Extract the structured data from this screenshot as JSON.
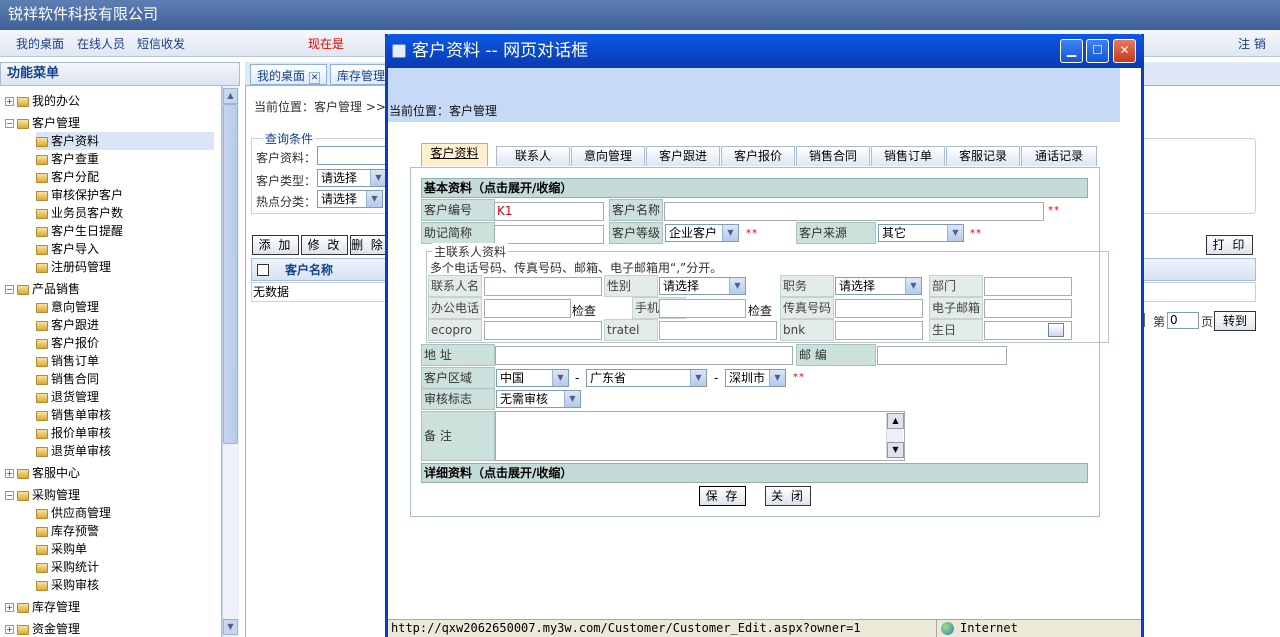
{
  "app": {
    "company": "锐祥软件科技有限公司",
    "nav": [
      "我的桌面",
      "在线人员",
      "短信收发"
    ],
    "now_label": "现在是",
    "logout": "注 销"
  },
  "sidebar": {
    "header": "功能菜单",
    "items": [
      {
        "label": "我的办公"
      },
      {
        "label": "客户管理"
      },
      {
        "label": "客户资料"
      },
      {
        "label": "客户查重"
      },
      {
        "label": "客户分配"
      },
      {
        "label": "审核保护客户"
      },
      {
        "label": "业务员客户数"
      },
      {
        "label": "客户生日提醒"
      },
      {
        "label": "客户导入"
      },
      {
        "label": "注册码管理"
      },
      {
        "label": "产品销售"
      },
      {
        "label": "意向管理"
      },
      {
        "label": "客户跟进"
      },
      {
        "label": "客户报价"
      },
      {
        "label": "销售订单"
      },
      {
        "label": "销售合同"
      },
      {
        "label": "退货管理"
      },
      {
        "label": "销售单审核"
      },
      {
        "label": "报价单审核"
      },
      {
        "label": "退货单审核"
      },
      {
        "label": "客服中心"
      },
      {
        "label": "采购管理"
      },
      {
        "label": "供应商管理"
      },
      {
        "label": "库存预警"
      },
      {
        "label": "采购单"
      },
      {
        "label": "采购统计"
      },
      {
        "label": "采购审核"
      },
      {
        "label": "库存管理"
      },
      {
        "label": "资金管理"
      }
    ]
  },
  "main": {
    "tabs": [
      "我的桌面",
      "库存管理"
    ],
    "breadcrumb": "当前位置：客户管理 >>",
    "query_legend": "查询条件",
    "query_labels": [
      "客户资料：",
      "客户类型：",
      "热点分类："
    ],
    "query_selects": [
      "请选择",
      "请选择"
    ],
    "buttons": [
      "添 加",
      "修 改",
      "删 除"
    ],
    "print_btn": "打 印",
    "grid_header": "客户名称",
    "no_data": "无数据",
    "pager": {
      "page_label": "第",
      "page_value": "0",
      "page_suffix": "页",
      "goto": "转到"
    }
  },
  "dialog": {
    "title": "客户资料 -- 网页对话框",
    "location": "当前位置：客户管理",
    "tabs": [
      "客户资料",
      "联系人",
      "意向管理",
      "客户跟进",
      "客户报价",
      "销售合同",
      "销售订单",
      "客服记录",
      "通话记录"
    ],
    "basic_section": "基本资料（点击展开/收缩）",
    "detail_section": "详细资料（点击展开/收缩）",
    "fields": {
      "cust_no_label": "客户编号",
      "cust_no_value": "K1",
      "cust_name_label": "客户名称",
      "mnemonic_label": "助记简称",
      "grade_label": "客户等级",
      "grade_value": "企业客户",
      "source_label": "客户来源",
      "source_value": "其它",
      "contact_legend": "主联系人资料",
      "contact_hint": "多个电话号码、传真号码、邮箱、电子邮箱用“,”分开。",
      "contact_name_label": "联系人名",
      "gender_label": "性别",
      "gender_value": "请选择",
      "position_label": "职务",
      "position_value": "请选择",
      "dept_label": "部门",
      "office_phone_label": "办公电话",
      "check1": "检查",
      "mobile_label": "手机号码",
      "check2": "检查",
      "fax_label": "传真号码",
      "email_label": "电子邮箱",
      "ecopro_label": "ecopro",
      "tratel_label": "tratel",
      "bnk_label": "bnk",
      "birthday_label": "生日",
      "address_label": "地  址",
      "postcode_label": "邮  编",
      "region_label": "客户区域",
      "country_value": "中国",
      "province_value": "广东省",
      "city_value": "深圳市",
      "audit_label": "审核标志",
      "audit_value": "无需审核",
      "remark_label": "备  注",
      "required_mark": "**",
      "dash": "-"
    },
    "save_btn": "保 存",
    "close_btn": "关 闭",
    "status_url": "http://qxw2062650007.my3w.com/Customer/Customer_Edit.aspx?owner=1",
    "status_zone": "Internet"
  }
}
